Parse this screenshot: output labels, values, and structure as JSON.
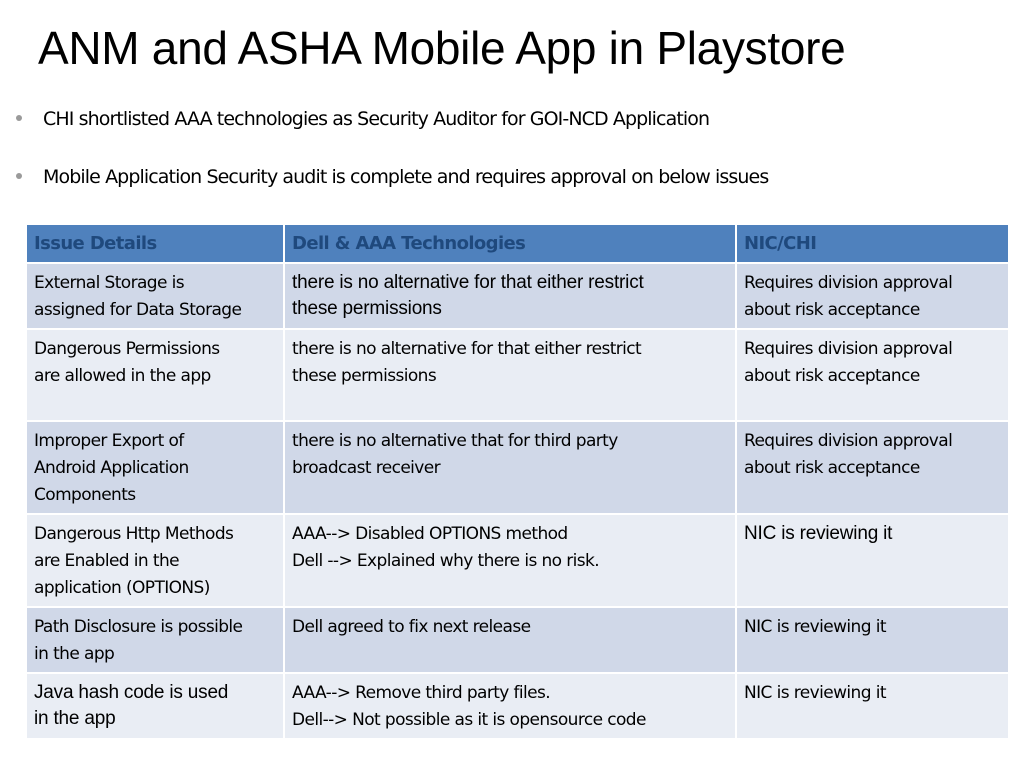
{
  "slide": {
    "title": "ANM and ASHA Mobile App in Playstore",
    "bullets": [
      "CHI shortlisted AAA technologies as Security Auditor for GOI-NCD Application",
      "Mobile Application Security audit is complete and requires approval on below issues"
    ]
  },
  "colors": {
    "header_bg": "#4f81bd",
    "header_text": "#1f497d",
    "row_dark": "#d0d8e8",
    "row_light": "#e9edf4"
  },
  "table": {
    "headers": [
      "Issue Details",
      "Dell  & AAA Technologies",
      "NIC/CHI"
    ],
    "rows": [
      {
        "issue": [
          "External Storage is",
          "assigned for Data Storage"
        ],
        "vendor": [
          "there is no alternative for that either restrict",
          "these permissions"
        ],
        "nic": [
          "Requires division approval",
          "about risk acceptance"
        ]
      },
      {
        "issue": [
          "Dangerous Permissions",
          "are allowed in the app"
        ],
        "vendor": [
          "there is no alternative for that either restrict",
          "these permissions"
        ],
        "nic": [
          "Requires division approval",
          "about risk acceptance"
        ]
      },
      {
        "issue": [
          "Improper Export of",
          "Android Application",
          "Components"
        ],
        "vendor": [
          "there is no alternative that for third party",
          "broadcast receiver"
        ],
        "nic": [
          "Requires division approval",
          "about risk acceptance"
        ]
      },
      {
        "issue": [
          "Dangerous Http Methods",
          "are Enabled in the",
          "application (OPTIONS)"
        ],
        "vendor": [
          "AAA--> Disabled OPTIONS method",
          "Dell --> Explained why there is no risk."
        ],
        "nic": [
          "NIC is reviewing it"
        ]
      },
      {
        "issue": [
          "Path Disclosure is possible",
          "in the app"
        ],
        "vendor": [
          "Dell agreed to fix next release"
        ],
        "nic": [
          "NIC is reviewing it"
        ]
      },
      {
        "issue": [
          "Java hash code is used",
          "in the app"
        ],
        "vendor": [
          "AAA--> Remove third party files.",
          "Dell--> Not possible as it is opensource code"
        ],
        "nic": [
          "NIC is reviewing it"
        ]
      }
    ]
  }
}
